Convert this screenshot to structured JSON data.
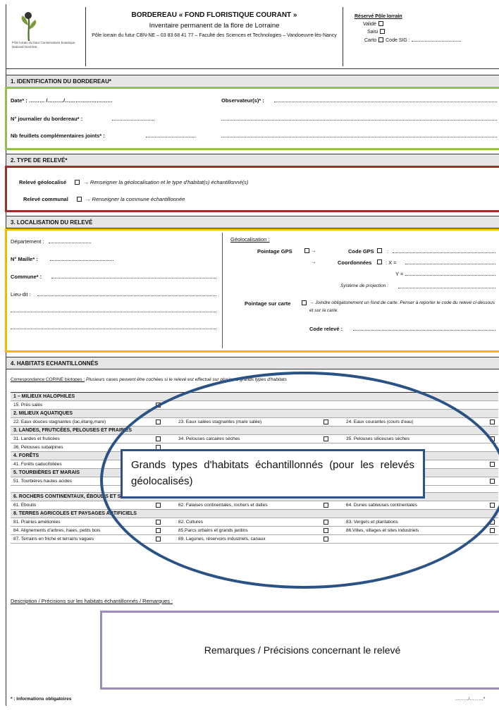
{
  "header": {
    "logo_text": "Pôle lorrain du futur Conservatoire botanique National Nord-Est",
    "title": "BORDEREAU « FOND FLORISTIQUE COURANT »",
    "subtitle": "Inventaire permanent de la flore de Lorraine",
    "institution": "Pôle lorrain du futur CBN-NE – 03 83 68 41 77 – Faculté des Sciences et Technologies – Vandoeuvre-lès-Nancy",
    "reserve_title": "Réservé Pôle lorrain",
    "reserve_valide": "Validé",
    "reserve_saisi": "Saisi",
    "reserve_carto": "Carto",
    "reserve_sig": "Code SIG :"
  },
  "s1": {
    "title": "1. IDENTIFICATION DU BORDEREAU*",
    "date": "Date* : ……… /………/………………………",
    "observateurs": "Observateur(s)* :",
    "journalier": "N° journalier du bordereau* :",
    "feuillets": "Nb feuillets complémentaires joints* :"
  },
  "s2": {
    "title": "2. TYPE DE RELEVÉ*",
    "geo_label": "Relevé géolocalisé",
    "geo_text": "→ Renseigner la géolocalisation et le type d'habitat(s) échantillonné(s)",
    "comm_label": "Relevé communal",
    "comm_text": "→ Renseigner la commune échantillonnée"
  },
  "s3": {
    "title": "3. LOCALISATION DU RELEVÉ",
    "departement": "Département :",
    "maille": "N° Maille* :",
    "commune": "Commune* :",
    "lieudit": "Lieu-dit :",
    "geoloc": "Géolocalisation :",
    "gps": "Pointage GPS",
    "arrow": "→",
    "code_gps": "Code GPS",
    "coordonnees": "Coordonnées",
    "x": ": X =",
    "y": "Y =",
    "projection": "Système de projection :",
    "carte": "Pointage sur carte",
    "carte_note": "→ Joindre obligatoirement un fond de carte. Penser à reporter le code du relevé ci-dessous et sur la carte.",
    "code_releve": "Code relevé :"
  },
  "s4": {
    "title": "4. HABITATS ECHANTILLONNÉS",
    "corine": "Correspondance CORINE biotopes :",
    "corine_note": "Plusieurs cases peuvent être cochées si le relevé est effectué sur plusieurs grands types d'habitats",
    "rows": [
      {
        "cat": "1 – MILIEUX HALOPHILES"
      },
      {
        "items": [
          "15. Prés salés"
        ]
      },
      {
        "cat": "2. MILIEUX AQUATIQUES"
      },
      {
        "items": [
          "22. Eaux douces stagnantes (lac,étang,mare)",
          "23. Eaux salées stagnantes (mare salée)",
          "24. Eaux courantes (cours d'eau)"
        ]
      },
      {
        "cat": "3. LANDES, FRUTICÉES, PELOUSES ET PRAIRIES"
      },
      {
        "items": [
          "31. Landes et fruticées",
          "34. Pelouses calcaires sèches",
          "35. Pelouses siliceuses sèches"
        ]
      },
      {
        "items": [
          "36. Pelouses subalpines"
        ]
      },
      {
        "cat": "4. FORÊTS"
      },
      {
        "items": [
          "41. Forêts caducifoliées",
          "",
          "…ets très humides"
        ]
      },
      {
        "cat": "5. TOURBIÈRES ET MARAIS"
      },
      {
        "items": [
          "51. Tourbières hautes acides",
          "",
          "…s de transition"
        ]
      },
      {
        "gap": true
      },
      {
        "cat": "6. ROCHERS CONTINENTAUX, ÉBOULIS ET SABLES"
      },
      {
        "items": [
          "61. Eboulis",
          "62. Falaises continentales, rochers et dalles",
          "64. Dunes sableuses continentales"
        ]
      },
      {
        "cat": "8. TERRES AGRICOLES ET PAYSAGES ARTIFICIELS"
      },
      {
        "items": [
          "81. Prairies améliorées",
          "82. Cultures",
          "83. Vergers et plantations"
        ]
      },
      {
        "items": [
          "84. Alignements d'arbres, haies, petits bois",
          "85.Parcs urbains et grands jardins",
          "86.Villes, villages et sites industriels"
        ]
      },
      {
        "items": [
          "87. Terrains en friche et terrains vagues",
          "89. Lagunes, réservoirs industriels, canaux",
          ""
        ]
      }
    ],
    "callout": "Grands types d'habitats échantillonnés (pour les relevés géolocalisés)",
    "description": "Description / Précisions sur les habitats échantillonnés / Remarques :",
    "remarks": "Remarques / Précisions concernant le relevé"
  },
  "footer": {
    "obligatoire": "* : Informations obligatoires",
    "page": "………/………*"
  },
  "colors": {
    "green": "#92c04c",
    "red": "#9b2f2c",
    "orange": "#f5b800",
    "purple": "#9d8cba",
    "blue": "#2b5285"
  }
}
